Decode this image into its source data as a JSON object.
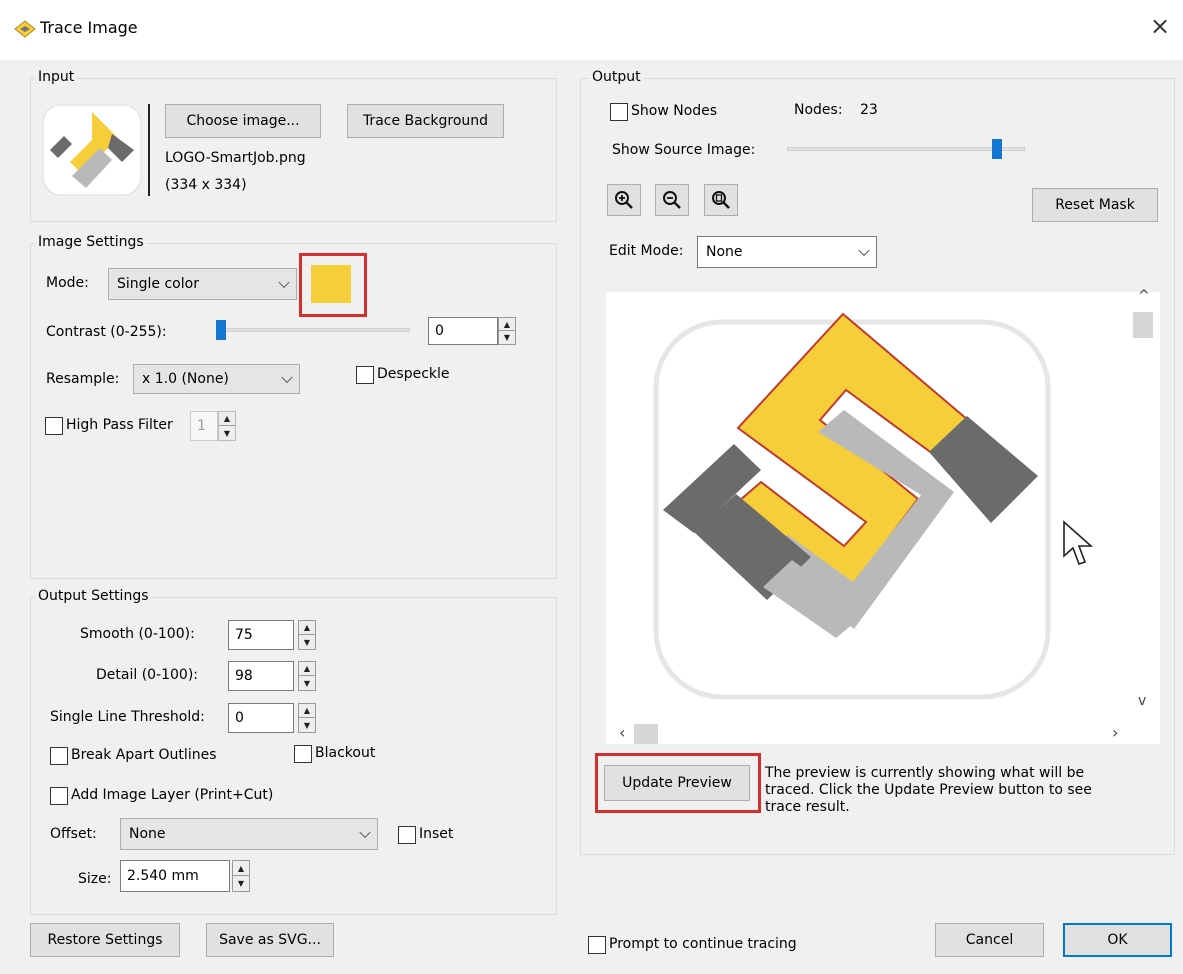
{
  "window": {
    "title": "Trace Image",
    "close": "×"
  },
  "input": {
    "legend": "Input",
    "choose_label": "Choose image...",
    "trace_bg_label": "Trace Background",
    "filename": "LOGO-SmartJob.png",
    "dimensions": "(334 x 334)"
  },
  "image_settings": {
    "legend": "Image Settings",
    "mode_label": "Mode:",
    "mode_value": "Single color",
    "color": "#f5ce3a",
    "contrast_label": "Contrast (0-255):",
    "contrast_value": "0",
    "contrast_fraction": 0.0,
    "resample_label": "Resample:",
    "resample_value": "x 1.0 (None)",
    "despeckle_label": "Despeckle",
    "highpass_label": "High Pass Filter",
    "highpass_value": "1"
  },
  "output_settings": {
    "legend": "Output Settings",
    "smooth_label": "Smooth (0-100):",
    "smooth_value": "75",
    "detail_label": "Detail (0-100):",
    "detail_value": "98",
    "slt_label": "Single Line Threshold:",
    "slt_value": "0",
    "break_apart_label": "Break Apart Outlines",
    "blackout_label": "Blackout",
    "add_layer_label": "Add Image Layer (Print+Cut)",
    "offset_label": "Offset:",
    "offset_value": "None",
    "inset_label": "Inset",
    "size_label": "Size:",
    "size_value": "2.540 mm"
  },
  "output": {
    "legend": "Output",
    "show_nodes_label": "Show Nodes",
    "nodes_label": "Nodes:",
    "nodes_value": "23",
    "show_source_label": "Show Source Image:",
    "source_fraction": 0.9,
    "reset_mask_label": "Reset Mask",
    "edit_mode_label": "Edit Mode:",
    "edit_mode_value": "None",
    "update_preview_label": "Update Preview",
    "hint_text": "The preview is currently showing what will be traced. Click the Update Preview button to see trace result."
  },
  "footer": {
    "restore_label": "Restore Settings",
    "save_svg_label": "Save as SVG...",
    "prompt_label": "Prompt to continue tracing",
    "cancel_label": "Cancel",
    "ok_label": "OK"
  },
  "colors": {
    "logo_yellow": "#f5ce3a",
    "logo_gray_dark": "#6b6b6b",
    "logo_gray_light": "#b9b9b9",
    "highlight_red": "#d32f2f",
    "slider_blue": "#1377d2"
  },
  "icons": [
    "trace-app-icon",
    "close-icon",
    "zoom-in-icon",
    "zoom-out-icon",
    "zoom-fit-icon",
    "scroll-up-icon",
    "scroll-down-icon",
    "scroll-left-icon",
    "scroll-right-icon",
    "mouse-cursor-icon"
  ]
}
